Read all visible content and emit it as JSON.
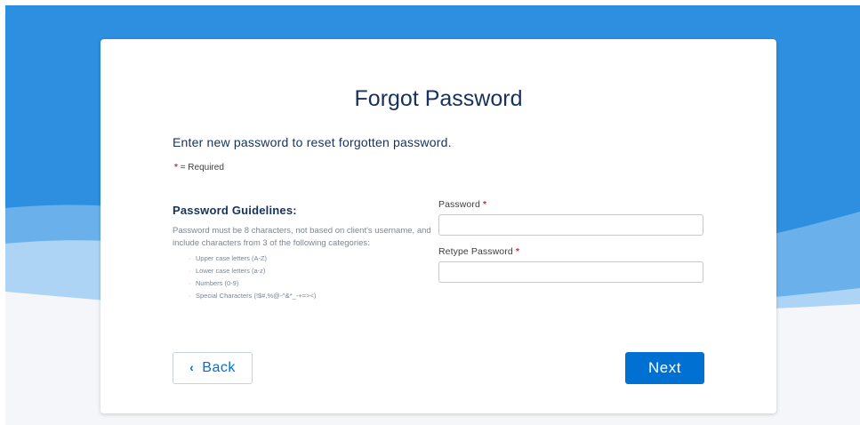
{
  "page": {
    "title": "Forgot Password",
    "intro": "Enter new password to reset forgotten password.",
    "required_note": "= Required",
    "required_mark": "*"
  },
  "guidelines": {
    "heading": "Password Guidelines:",
    "text": "Password must be 8 characters, not based on client's username, and include characters from 3 of the following categories:",
    "items": [
      "Upper case letters (A-Z)",
      "Lower case letters (a-z)",
      "Numbers (0-9)",
      "Special Characters (!$#,%@-^&*_-+=><)"
    ]
  },
  "fields": {
    "password": {
      "label": "Password",
      "value": "",
      "placeholder": ""
    },
    "retype_password": {
      "label": "Retype Password",
      "value": "",
      "placeholder": ""
    }
  },
  "buttons": {
    "back_label": "Back",
    "back_icon": "chevron-left-icon",
    "next_label": "Next"
  },
  "colors": {
    "background_blue": "#2e8fe0",
    "primary_button": "#0070d2",
    "title_text": "#16325c",
    "required_red": "#c23934"
  }
}
